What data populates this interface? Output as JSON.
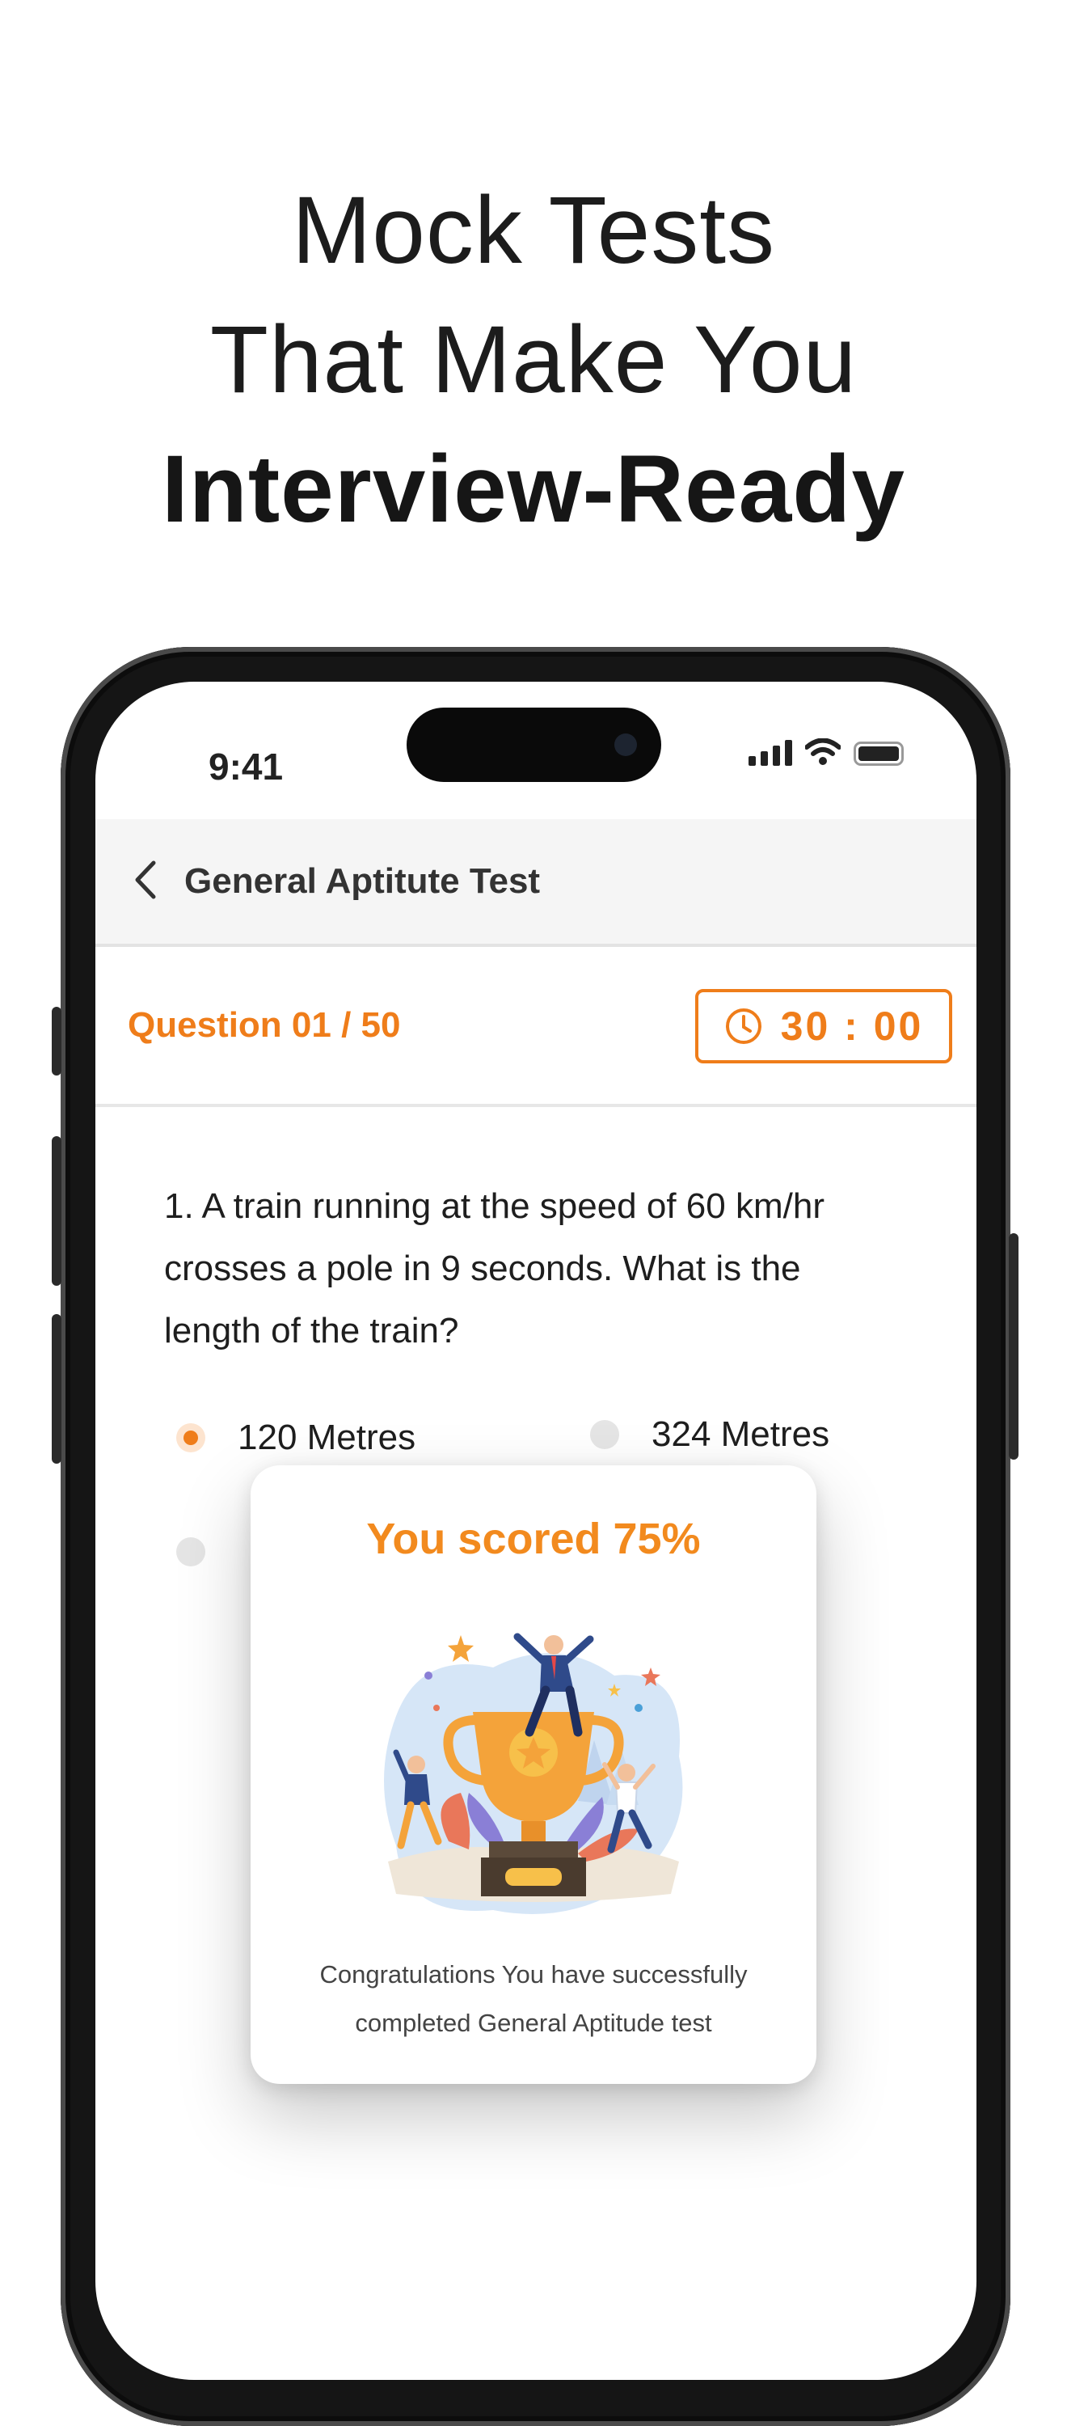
{
  "headline": {
    "line1": "Mock Tests",
    "line2": "That Make You",
    "line3": "Interview-Ready"
  },
  "status_bar": {
    "time": "9:41",
    "icons": [
      "signal-icon",
      "wifi-icon",
      "battery-icon"
    ]
  },
  "app_header": {
    "back_icon": "chevron-left-icon",
    "title": "General Aptitute Test"
  },
  "question_bar": {
    "counter": "Question 01 / 50",
    "timer_icon": "clock-icon",
    "timer": "30 : 00"
  },
  "question": {
    "text": "1.  A train running at the speed of 60 km/hr crosses a pole in 9 seconds. What is the length of the train?",
    "options": [
      {
        "label": "120 Metres",
        "selected": true
      },
      {
        "label": "324 Metres",
        "selected": false
      }
    ]
  },
  "result_modal": {
    "score": "You scored 75%",
    "illustration": "trophy-celebration-illustration",
    "message": "Congratulations You have successfully completed General Aptitude test"
  },
  "colors": {
    "accent": "#ef7d1a",
    "score": "#f28a1e",
    "text": "#1e1e1e",
    "header_bg": "#f5f5f5"
  }
}
